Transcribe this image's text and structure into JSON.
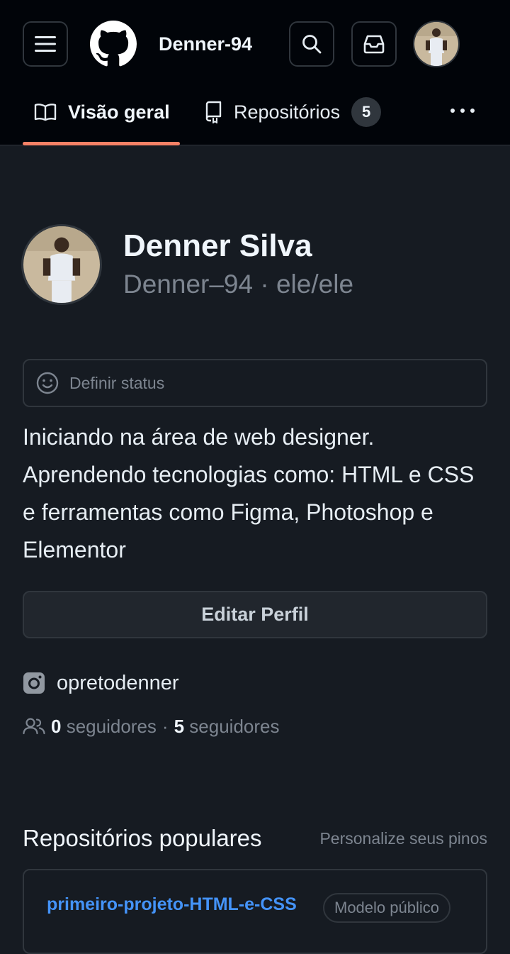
{
  "header": {
    "username": "Denner-94",
    "icons": {
      "menu": "hamburger-menu-icon",
      "logo": "github-logo-icon",
      "search": "search-icon",
      "inbox": "inbox-icon",
      "avatar": "user-avatar"
    }
  },
  "tabs": [
    {
      "label": "Visão geral",
      "icon": "book-icon",
      "active": true
    },
    {
      "label": "Repositórios",
      "icon": "repo-icon",
      "count": "5"
    }
  ],
  "profile": {
    "full_name": "Denner Silva",
    "login": "Denner–94",
    "separator": " · ",
    "pronouns": "ele/ele",
    "status_placeholder": "Definir status",
    "bio": "Iniciando na área de web designer. Aprendendo tecnologias como: HTML e CSS e ferramentas como Figma, Photoshop e Elementor",
    "edit_button": "Editar Perfil",
    "social_handle": "opretodenner",
    "followers_count": "0",
    "followers_label": "seguidores",
    "following_count": "5",
    "following_label": "seguidores",
    "dot": "·"
  },
  "popular": {
    "title": "Repositórios populares",
    "customize_link": "Personalize seus pinos",
    "repos": [
      {
        "name": "primeiro-projeto-HTML-e-CSS",
        "badge": "Modelo público"
      }
    ]
  },
  "colors": {
    "background": "#161b22",
    "header": "#010409",
    "accent_underline": "#f78166",
    "link": "#4493f8",
    "muted": "#7d8590",
    "border": "#30363d"
  }
}
